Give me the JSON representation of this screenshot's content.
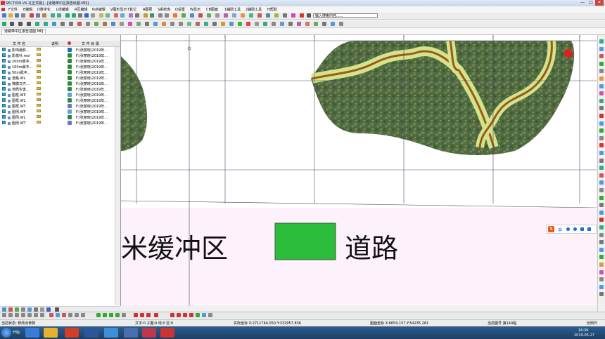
{
  "window": {
    "title": "SECTION V4.1[正式版] - [道路带中区报告绘图.MPJ]",
    "min": "—",
    "max": "□",
    "close": "✕"
  },
  "menu": [
    "F文件",
    "E编辑",
    "D数字化",
    "L线编辑",
    "R区编辑",
    "N点编辑",
    "V图形显示",
    "T其它",
    "A图层",
    "S系统库",
    "O设置",
    "W显示",
    "CB图面",
    "1辅助工具",
    "2辅助工具",
    "H帮助"
  ],
  "search": {
    "value": "输入搜索内容......"
  },
  "tab": {
    "label": "道路带中区报告插图.MPJ"
  },
  "panel": {
    "headers": {
      "name": "文 件 名",
      "desc": "说明",
      "path": "文 件 目 录"
    },
    "rows": [
      {
        "name": "影响最影...",
        "path": "F:\\张丽晓\\2019年..."
      },
      {
        "name": "影像补.msi",
        "path": "F:\\张丽晓\\2019年..."
      },
      {
        "name": "200m缓冲...",
        "path": "F:\\张丽晓\\2019年..."
      },
      {
        "name": "100m缓冲...",
        "path": "F:\\张丽晓\\2019年..."
      },
      {
        "name": "50m缓冲...",
        "path": "F:\\张丽晓\\2019年..."
      },
      {
        "name": "道路.WL",
        "path": "F:\\张丽晓\\2019年..."
      },
      {
        "name": "掩膜文件...",
        "path": "F:\\张丽晓\\2019年..."
      },
      {
        "name": "地质灾害...",
        "path": "F:\\张丽晓\\2019年..."
      },
      {
        "name": "图框.WP",
        "path": "F:\\张丽晓\\2019年..."
      },
      {
        "name": "图框.WL",
        "path": "F:\\张丽晓\\2019年..."
      },
      {
        "name": "图框.WT",
        "path": "F:\\张丽晓\\2019年..."
      },
      {
        "name": "图例.WP",
        "path": "F:\\张丽晓\\2019年..."
      },
      {
        "name": "图例.WL",
        "path": "F:\\张丽晓\\2019年..."
      },
      {
        "name": "图例.WT",
        "path": "F:\\张丽晓\\2019年..."
      }
    ],
    "layer_icon_colors": [
      "#1b6fbf",
      "#2a8a3a",
      "#2a8a3a",
      "#2a8a3a",
      "#2a8a3a",
      "#2a8a3a",
      "#2a8a3a",
      "#2a8a3a",
      "#5fa0d8",
      "#2a8a3a",
      "#7a6fbf",
      "#5fa0d8",
      "#2a8a3a",
      "#7a6fbf"
    ]
  },
  "map": {
    "legend_left_text": "米缓冲区",
    "legend_right_text": "道路",
    "legend_swatch_color": "#2dbd3d",
    "legend_bg": "#fdf1fb",
    "road_color": "#9b5a1e",
    "buffer_color": "#d4e48a"
  },
  "status": {
    "left": "当前状态: 修改点参数",
    "text_info": "文字:0  子图:0  线:0  区:0",
    "real_coord": "实际坐标 X:2711764.050,Y:332957.836",
    "map_coord": "图面坐标 X:6659.157,Y:54235.281",
    "current_map": "当前图号 第144幅",
    "scale": "比例尺"
  },
  "taskbar": {
    "start": "开始",
    "time": "16:36",
    "date": "2019-05-27"
  },
  "ime": {
    "logo": "S",
    "label": "中"
  }
}
